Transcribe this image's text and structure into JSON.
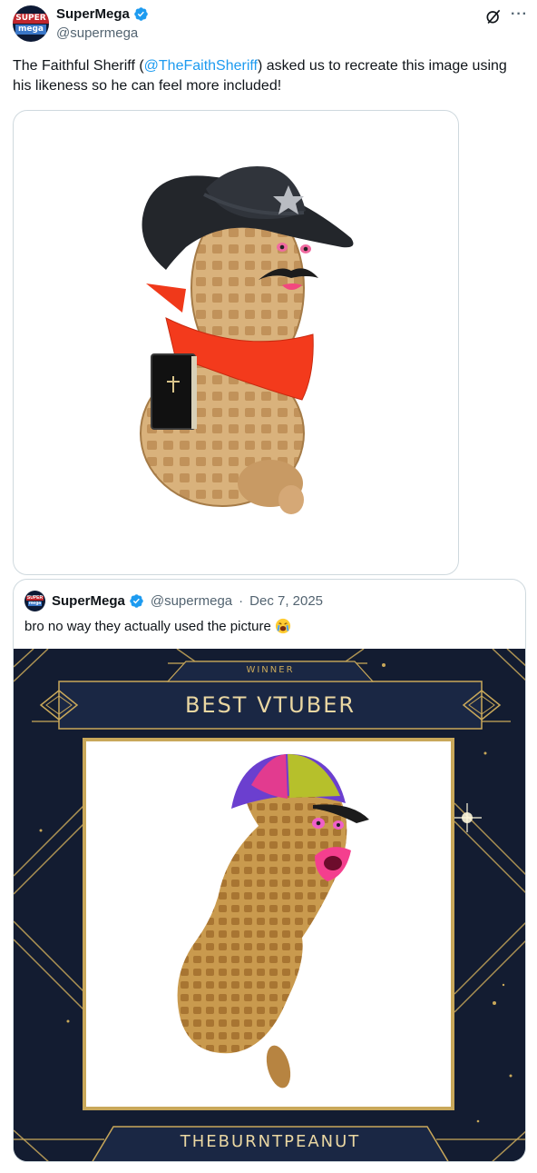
{
  "tweet": {
    "author_name": "SuperMega",
    "author_handle": "@supermega",
    "avatar_top": "SUPER",
    "avatar_bottom": "mega",
    "text_before": "The Faithful Sheriff (",
    "mention": "@TheFaithSheriff",
    "text_after": ") asked us to recreate this image using his likeness so he can feel more included!",
    "more_label": "···"
  },
  "quote": {
    "author_name": "SuperMega",
    "author_handle": "@supermega",
    "separator": "·",
    "date": "Dec 7, 2025",
    "text": "bro no way they actually used the picture",
    "emoji": "crying-face-emoji"
  },
  "award": {
    "winner_label": "WINNER",
    "category": "BEST VTUBER",
    "recipient": "THEBURNTPEANUT"
  },
  "colors": {
    "link": "#1d9bf0",
    "verified": "#1d9bf0",
    "award_bg": "#131c31",
    "award_gold": "#c9a85a"
  }
}
